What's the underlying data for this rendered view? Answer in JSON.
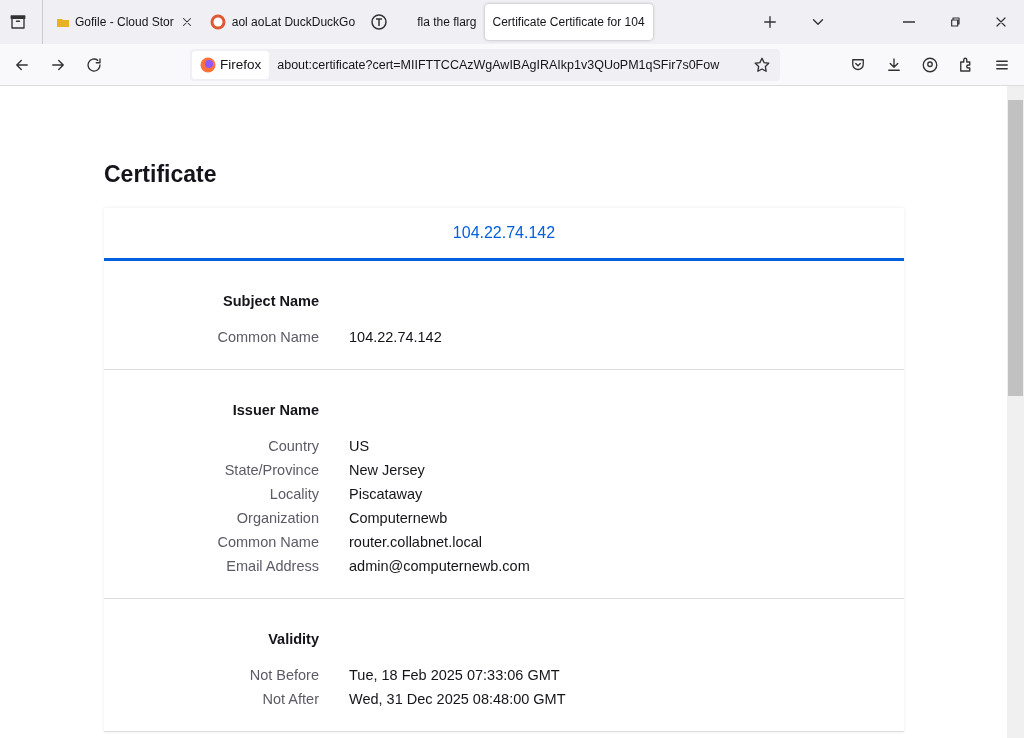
{
  "tabs": [
    {
      "title": "Gofile - Cloud Stor",
      "kind": "folder",
      "closable": true,
      "selected": false
    },
    {
      "title": "aol aoLat DuckDuckGo",
      "kind": "duck",
      "closable": false,
      "selected": false
    },
    {
      "kind": "t",
      "closable": false,
      "selected": false
    },
    {
      "title": "fla  the flarg",
      "kind": "plain",
      "closable": false,
      "selected": false
    },
    {
      "title": "Certificate Certificate for 104",
      "kind": "plain",
      "closable": false,
      "selected": true
    }
  ],
  "address_bar": {
    "identity": "Firefox",
    "url": "about:certificate?cert=MIIFTTCCAzWgAwIBAgIRAIkp1v3QUoPM1qSFir7s0Fow"
  },
  "page": {
    "heading": "Certificate",
    "cert_tab": "104.22.74.142",
    "sections": [
      {
        "title": "Subject Name",
        "rows": [
          {
            "label": "Common Name",
            "value": "104.22.74.142"
          }
        ]
      },
      {
        "title": "Issuer Name",
        "rows": [
          {
            "label": "Country",
            "value": "US"
          },
          {
            "label": "State/Province",
            "value": "New Jersey"
          },
          {
            "label": "Locality",
            "value": "Piscataway"
          },
          {
            "label": "Organization",
            "value": "Computernewb"
          },
          {
            "label": "Common Name",
            "value": "router.collabnet.local"
          },
          {
            "label": "Email Address",
            "value": "admin@computernewb.com"
          }
        ]
      },
      {
        "title": "Validity",
        "rows": [
          {
            "label": "Not Before",
            "value": "Tue, 18 Feb 2025 07:33:06 GMT"
          },
          {
            "label": "Not After",
            "value": "Wed, 31 Dec 2025 08:48:00 GMT"
          }
        ]
      }
    ]
  }
}
